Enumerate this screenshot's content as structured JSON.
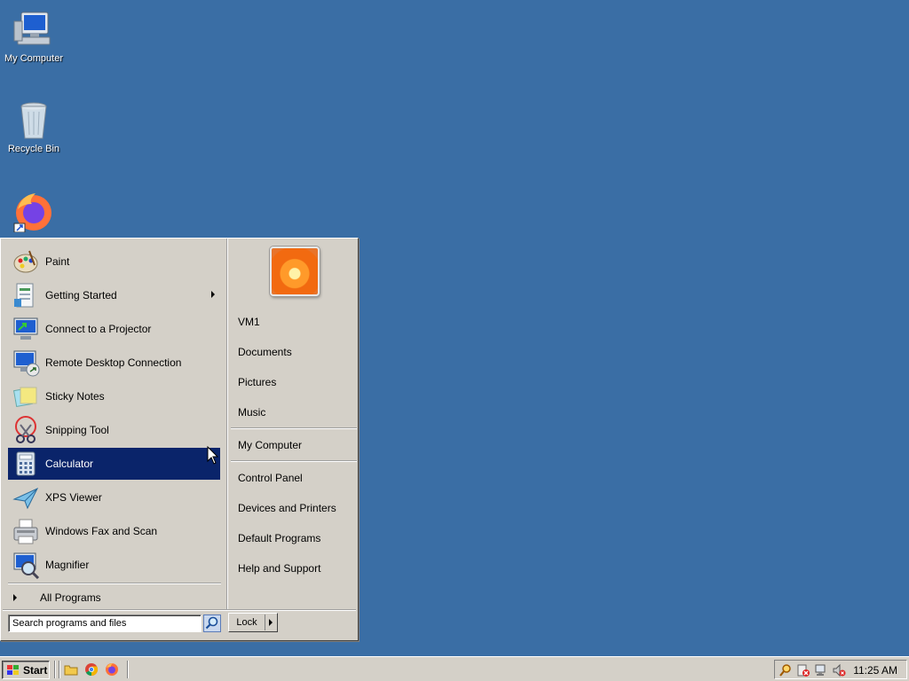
{
  "desktop": {
    "icons": [
      {
        "label": "My Computer"
      },
      {
        "label": "Recycle Bin"
      },
      {
        "label": ""
      }
    ]
  },
  "start_menu": {
    "programs": [
      {
        "label": "Paint",
        "has_submenu": false,
        "selected": false
      },
      {
        "label": "Getting Started",
        "has_submenu": true,
        "selected": false
      },
      {
        "label": "Connect to a Projector",
        "has_submenu": false,
        "selected": false
      },
      {
        "label": "Remote Desktop Connection",
        "has_submenu": false,
        "selected": false
      },
      {
        "label": "Sticky Notes",
        "has_submenu": false,
        "selected": false
      },
      {
        "label": "Snipping Tool",
        "has_submenu": false,
        "selected": false
      },
      {
        "label": "Calculator",
        "has_submenu": false,
        "selected": true
      },
      {
        "label": "XPS Viewer",
        "has_submenu": false,
        "selected": false
      },
      {
        "label": "Windows Fax and Scan",
        "has_submenu": false,
        "selected": false
      },
      {
        "label": "Magnifier",
        "has_submenu": false,
        "selected": false
      }
    ],
    "all_programs": "All Programs",
    "search_placeholder": "Search programs and files",
    "lock_label": "Lock",
    "right_links": {
      "user": "VM1",
      "documents": "Documents",
      "pictures": "Pictures",
      "music": "Music",
      "computer": "My Computer",
      "control_panel": "Control Panel",
      "devices": "Devices and Printers",
      "default_programs": "Default Programs",
      "help": "Help and Support"
    }
  },
  "taskbar": {
    "start_label": "Start",
    "clock": "11:25 AM"
  },
  "colors": {
    "desktop": "#3a6ea5",
    "selection": "#0a246a",
    "face": "#d4d0c8"
  }
}
